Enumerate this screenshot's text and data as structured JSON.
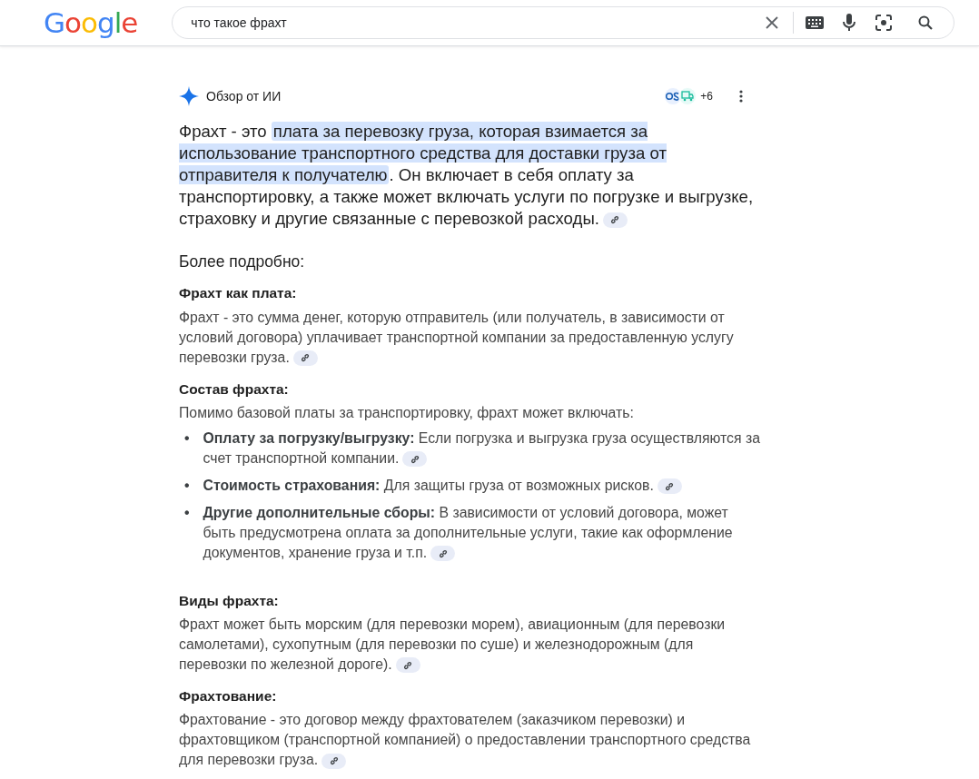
{
  "header": {
    "logo": "Google",
    "search": {
      "value": "что такое фрахт"
    }
  },
  "overview": {
    "title": "Обзор от ИИ",
    "sources": {
      "more": "+6"
    },
    "intro": [
      {
        "text": "Фрахт - это ",
        "highlighted": false
      },
      {
        "text": "плата за перевозку груза, которая взимается за использование транспортного средства для доставки груза от отправителя к получателю",
        "highlighted": true
      },
      {
        "text": ". Он включает в себя оплату за транспортировку, а также может включать услуги по погрузке и выгрузке, страховку и другие связанные с перевозкой расходы.",
        "highlighted": false
      }
    ],
    "heading": "Более подробно:",
    "sections": [
      {
        "title": "Фрахт как плата:",
        "text": "Фрахт - это сумма денег, которую отправитель (или получатель, в зависимости от условий договора) уплачивает транспортной компании за предоставленную услугу перевозки груза.",
        "link": true
      },
      {
        "title": "Состав фрахта:",
        "text": "Помимо базовой платы за транспортировку, фрахт может включать:",
        "link": false,
        "bullets": [
          {
            "marker": "•",
            "text": "**Оплату за погрузку/выгрузку:** Если погрузка и выгрузка груза осуществляются за счет транспортной компании."
          },
          {
            "marker": "•",
            "text": "**Стоимость страхования:** Для защиты груза от возможных рисков."
          },
          {
            "marker": "•",
            "text": "**Другие дополнительные сборы:** В зависимости от условий договора, может быть предусмотрена оплата за дополнительные услуги, такие как оформление документов, хранение груза и т.п."
          }
        ]
      },
      {
        "title": "Виды фрахта:",
        "text": "Фрахт может быть морским (для перевозки морем), авиационным (для перевозки самолетами), сухопутным (для перевозки по суше) и железнодорожным (для перевозки по железной дороге).",
        "link": true
      },
      {
        "title": "Фрахтование:",
        "text": "Фрахтование - это договор между фрахтователем (заказчиком перевозки) и фрахтовщиком (транспортной компанией) о предоставлении транспортного средства для перевозки груза.",
        "link": true
      }
    ]
  }
}
